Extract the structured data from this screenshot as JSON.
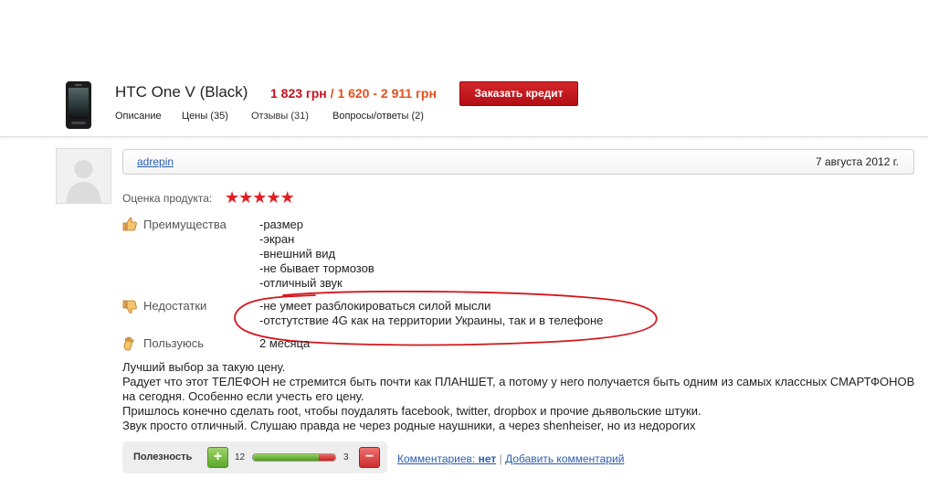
{
  "product": {
    "title": "HTC One V (Black)",
    "price_main": "1 823 грн",
    "price_sep": " / ",
    "price_range": "1 620 - 2 911 грн",
    "credit_button": "Заказать кредит"
  },
  "tabs": [
    {
      "label": "Описание",
      "active": false
    },
    {
      "label": "Цены (35)",
      "active": false
    },
    {
      "label": "Отзывы (31)",
      "active": true
    },
    {
      "label": "Вопросы/ответы (2)",
      "active": false
    }
  ],
  "review": {
    "username": "adrepin",
    "date": "7 августа 2012 г.",
    "rating_label": "Оценка продукта:",
    "rating": 5,
    "rating_max": 5,
    "pros_label": "Преимущества",
    "pros": [
      "-размер",
      "-экран",
      "-внешний вид",
      "-не бывает тормозов",
      "-отличный звук"
    ],
    "cons_label": "Недостатки",
    "cons": [
      "-не умеет разблокироваться силой мысли",
      "-отстутствие 4G как на территории Украины, так и в телефоне"
    ],
    "usage_label": "Пользуюсь",
    "usage": "2 месяца",
    "body": [
      "Лучший выбор за такую цену.",
      "Радует что этот ТЕЛЕФОН не стремится быть почти как ПЛАНШЕТ, а потому у него получается быть одним из самых классных СМАРТФОНОВ на сегодня. Особенно если учесть его цену.",
      "Пришлось конечно сделать root, чтобы поудалять facebook, twitter, dropbox и прочие дьявольские штуки.",
      "Звук просто отличный. Слушаю правда не через родные наушники, а через shenheiser, но из недорогих"
    ]
  },
  "usefulness": {
    "label": "Полезность",
    "plus": "+",
    "minus": "−",
    "up_count": "12",
    "down_count": "3",
    "up_value": 12,
    "down_value": 3
  },
  "comments": {
    "label": "Комментариев:",
    "count": "нет",
    "separator": "|",
    "add": "Добавить комментарий"
  },
  "colors": {
    "accent_red": "#c2121e",
    "link_blue": "#2a5db0",
    "star_red": "#e31e24",
    "annotation_red": "#d4161c"
  }
}
